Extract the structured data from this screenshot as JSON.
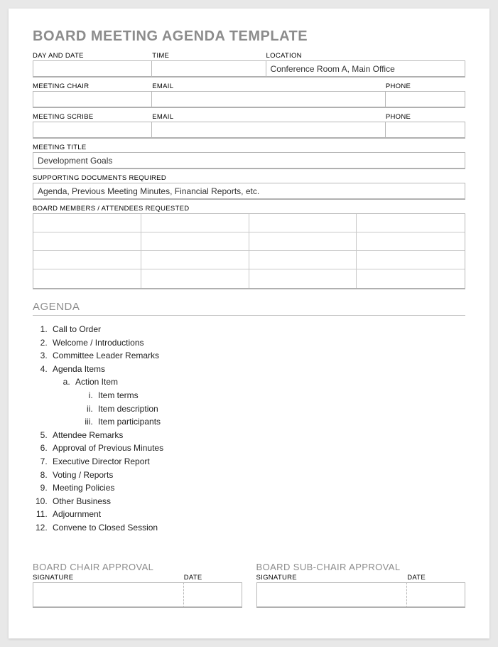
{
  "title": "BOARD MEETING AGENDA TEMPLATE",
  "header_row1": {
    "day_date_label": "DAY AND DATE",
    "day_date_value": "",
    "time_label": "TIME",
    "time_value": "",
    "location_label": "LOCATION",
    "location_value": "Conference Room A, Main Office"
  },
  "chair_row": {
    "chair_label": "MEETING CHAIR",
    "chair_value": "",
    "email_label": "EMAIL",
    "email_value": "",
    "phone_label": "PHONE",
    "phone_value": ""
  },
  "scribe_row": {
    "scribe_label": "MEETING SCRIBE",
    "scribe_value": "",
    "email_label": "EMAIL",
    "email_value": "",
    "phone_label": "PHONE",
    "phone_value": ""
  },
  "meeting_title": {
    "label": "MEETING TITLE",
    "value": "Development Goals"
  },
  "supporting_docs": {
    "label": "SUPPORTING DOCUMENTS REQUIRED",
    "value": "Agenda, Previous Meeting Minutes, Financial Reports, etc."
  },
  "attendees": {
    "label": "BOARD MEMBERS / ATTENDEES REQUESTED"
  },
  "agenda": {
    "heading": "AGENDA",
    "items": {
      "i1": "Call to Order",
      "i2": "Welcome / Introductions",
      "i3": "Committee Leader Remarks",
      "i4": "Agenda Items",
      "i4a": "Action Item",
      "i4a1": "Item terms",
      "i4a2": "Item description",
      "i4a3": "Item participants",
      "i5": "Attendee Remarks",
      "i6": "Approval of Previous Minutes",
      "i7": "Executive Director Report",
      "i8": "Voting / Reports",
      "i9": "Meeting Policies",
      "i10": "Other Business",
      "i11": "Adjournment",
      "i12": "Convene to Closed Session"
    }
  },
  "approvals": {
    "chair_title": "BOARD CHAIR APPROVAL",
    "subchair_title": "BOARD SUB-CHAIR APPROVAL",
    "signature_label": "SIGNATURE",
    "date_label": "DATE"
  }
}
